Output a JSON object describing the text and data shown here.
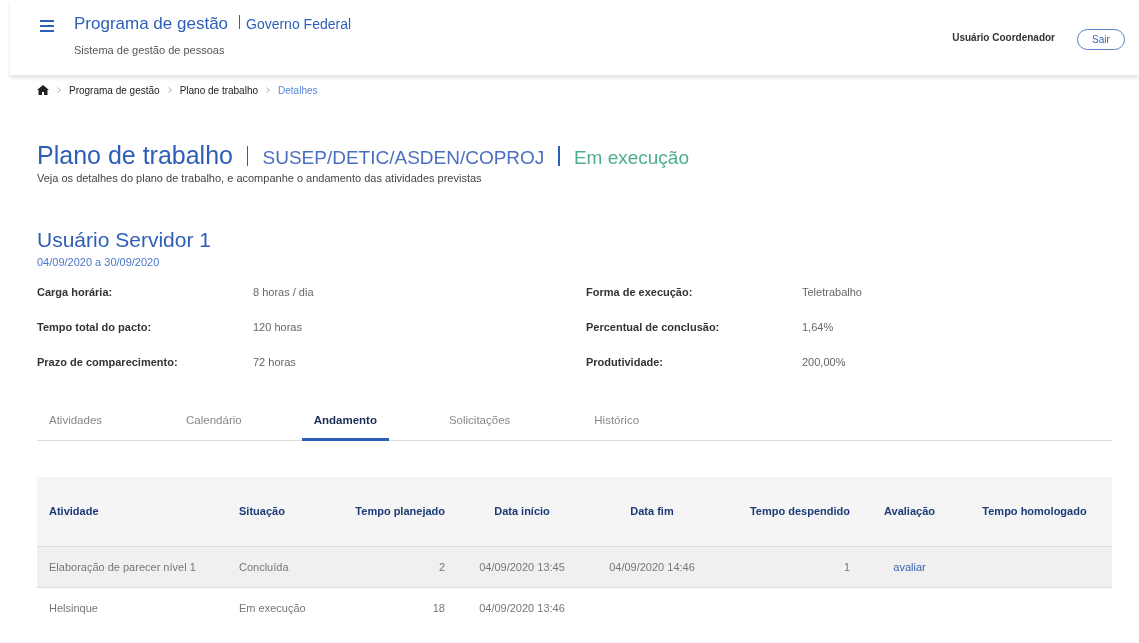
{
  "header": {
    "app_title": "Programa de gestão",
    "org": "Governo Federal",
    "subtitle": "Sistema de gestão de pessoas",
    "user": "Usuário Coordenador",
    "logout_button": "Sair"
  },
  "breadcrumb": [
    {
      "label": "Programa de gestão",
      "current": false
    },
    {
      "label": "Plano de trabalho",
      "current": false
    },
    {
      "label": "Detalhes",
      "current": true
    }
  ],
  "page": {
    "title": "Plano de trabalho",
    "unit": "SUSEP/DETIC/ASDEN/COPROJ",
    "status": "Em execução",
    "description": "Veja os detalhes do plano de trabalho, e acompanhe o andamento das atividades previstas"
  },
  "person": {
    "name": "Usuário Servidor 1",
    "period": "04/09/2020 a 30/09/2020"
  },
  "details_left": [
    {
      "label": "Carga horária:",
      "value": "8 horas / dia"
    },
    {
      "label": "Tempo total do pacto:",
      "value": "120 horas"
    },
    {
      "label": "Prazo de comparecimento:",
      "value": "72 horas"
    }
  ],
  "details_right": [
    {
      "label": "Forma de execução:",
      "value": "Teletrabalho"
    },
    {
      "label": "Percentual de conclusão:",
      "value": "1,64%"
    },
    {
      "label": "Produtividade:",
      "value": "200,00%"
    }
  ],
  "tabs": [
    {
      "label": "Atividades",
      "selected": false
    },
    {
      "label": "Calendário",
      "selected": false
    },
    {
      "label": "Andamento",
      "selected": true
    },
    {
      "label": "Solicitações",
      "selected": false
    },
    {
      "label": "Histórico",
      "selected": false
    }
  ],
  "table": {
    "columns": [
      "Atividade",
      "Situação",
      "Tempo planejado",
      "Data início",
      "Data fim",
      "Tempo despendido",
      "Avaliação",
      "Tempo homologado"
    ],
    "rows": [
      {
        "activity": "Elaboração de parecer nível 1",
        "status": "Concluída",
        "planned": "2",
        "start": "04/09/2020 13:45",
        "end": "04/09/2020 14:46",
        "spent": "1",
        "evaluation_link": "avaliar"
      },
      {
        "activity": "Helsinque",
        "status": "Em execução",
        "planned": "18",
        "start": "04/09/2020 13:46"
      }
    ]
  }
}
